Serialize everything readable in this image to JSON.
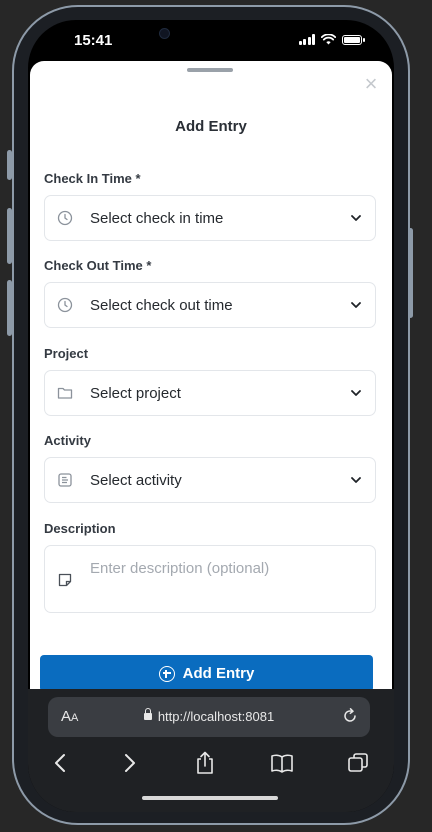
{
  "status_bar": {
    "time": "15:41"
  },
  "sheet": {
    "title": "Add Entry",
    "close_glyph": "×",
    "fields": [
      {
        "label": "Check In Time *",
        "value": "Select check in time",
        "icon": "clock-icon"
      },
      {
        "label": "Check Out Time *",
        "value": "Select check out time",
        "icon": "clock-icon"
      },
      {
        "label": "Project",
        "value": "Select project",
        "icon": "folder-icon"
      },
      {
        "label": "Activity",
        "value": "Select activity",
        "icon": "list-icon"
      }
    ],
    "description": {
      "label": "Description",
      "placeholder": "Enter description (optional)",
      "icon": "note-icon"
    },
    "submit_label": "Add Entry"
  },
  "browser": {
    "aa_label_big": "A",
    "aa_label_small": "A",
    "url": "http://localhost:8081"
  },
  "colors": {
    "primary": "#0a6cbf",
    "background": "#272727",
    "sheet": "#ffffff"
  }
}
